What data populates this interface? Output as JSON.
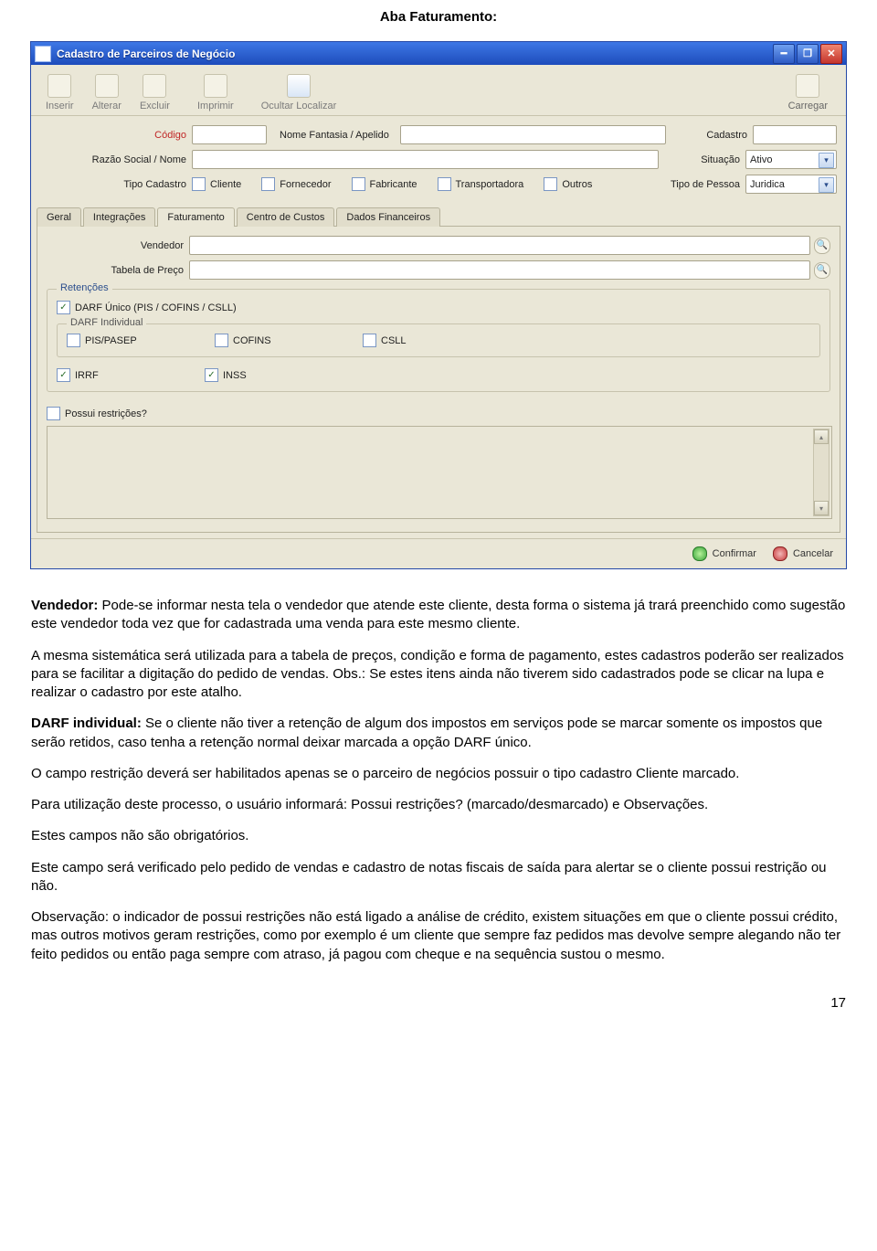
{
  "doc_title": "Aba Faturamento:",
  "window": {
    "title": "Cadastro de Parceiros de Negócio"
  },
  "toolbar": {
    "inserir": "Inserir",
    "alterar": "Alterar",
    "excluir": "Excluir",
    "imprimir": "Imprimir",
    "ocultar": "Ocultar Localizar",
    "carregar": "Carregar"
  },
  "header": {
    "codigo_label": "Código",
    "nomefantasia_label": "Nome Fantasia / Apelido",
    "cadastro_label": "Cadastro",
    "razao_label": "Razão Social / Nome",
    "situacao_label": "Situação",
    "situacao_value": "Ativo",
    "tipo_cadastro_label": "Tipo Cadastro",
    "cb_cliente": "Cliente",
    "cb_fornecedor": "Fornecedor",
    "cb_fabricante": "Fabricante",
    "cb_transportadora": "Transportadora",
    "cb_outros": "Outros",
    "tipopessoa_label": "Tipo de Pessoa",
    "tipopessoa_value": "Juridica"
  },
  "tabs": {
    "geral": "Geral",
    "integracoes": "Integrações",
    "faturamento": "Faturamento",
    "centrocustos": "Centro de Custos",
    "dadosfin": "Dados Financeiros"
  },
  "fat": {
    "vendedor_label": "Vendedor",
    "tabela_label": "Tabela de Preço",
    "retencoes_legend": "Retenções",
    "darf_unico": "DARF Único (PIS / COFINS / CSLL)",
    "darf_ind_legend": "DARF Individual",
    "pis": "PIS/PASEP",
    "cofins": "COFINS",
    "csll": "CSLL",
    "irrf": "IRRF",
    "inss": "INSS",
    "possui": "Possui restrições?"
  },
  "footer": {
    "confirmar": "Confirmar",
    "cancelar": "Cancelar"
  },
  "body": {
    "p1a": "Vendedor:",
    "p1b": " Pode-se informar nesta tela o vendedor que atende este cliente, desta forma o sistema já trará preenchido como sugestão este vendedor toda vez que for cadastrada uma venda para este mesmo cliente.",
    "p2": "A mesma sistemática será utilizada para a tabela de preços, condição e forma de pagamento, estes cadastros poderão ser realizados para se facilitar a digitação do pedido de vendas. Obs.: Se estes itens ainda não tiverem sido cadastrados pode se clicar na lupa e realizar o cadastro por este atalho.",
    "p3a": "DARF individual:",
    "p3b": " Se o cliente não tiver a retenção de algum dos impostos em serviços pode se marcar somente os impostos que serão retidos, caso tenha a retenção normal deixar marcada a opção DARF único.",
    "p4": "O campo restrição deverá ser habilitados apenas se o parceiro de negócios possuir o tipo cadastro Cliente marcado.",
    "p5": "Para utilização deste processo, o usuário informará: Possui restrições? (marcado/desmarcado) e Observações.",
    "p6": "Estes campos não são obrigatórios.",
    "p7": "Este campo será verificado pelo pedido de vendas e cadastro de notas fiscais de saída para alertar se o cliente possui restrição ou não.",
    "p8": "Observação: o indicador de possui restrições não está ligado a análise de crédito, existem situações em que o cliente possui crédito, mas outros motivos geram restrições, como por exemplo é um cliente que sempre faz pedidos mas devolve sempre alegando não ter feito pedidos ou então paga sempre com atraso, já pagou com cheque e na sequência sustou o mesmo."
  },
  "page_number": "17"
}
